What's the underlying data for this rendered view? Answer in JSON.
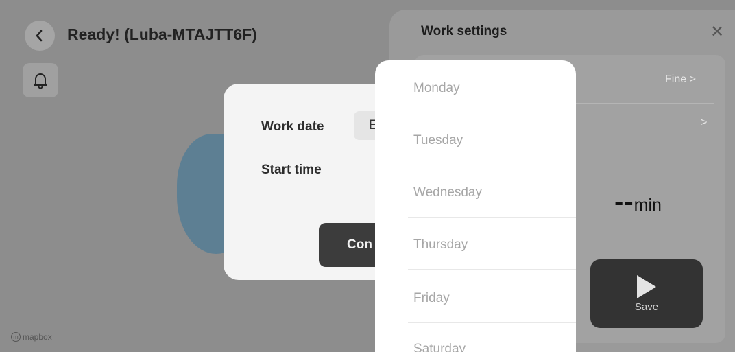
{
  "header": {
    "back_icon": "chevron-left-icon",
    "title": "Ready! (Luba-MTAJTT6F)",
    "notification_icon": "bell-icon"
  },
  "map": {
    "attribution": "mapbox",
    "zone_color": "#5d7f93"
  },
  "work_settings": {
    "title": "Work settings",
    "close_icon": "close-icon",
    "rows": [
      {
        "value": "Fine",
        "chevron": ">"
      },
      {
        "value": "",
        "chevron": ">"
      }
    ],
    "duration": {
      "value": "--",
      "unit": "min"
    },
    "save_label": "Save",
    "save_icon": "play-icon"
  },
  "schedule_dialog": {
    "work_date_label": "Work date",
    "work_date_value": "E",
    "start_time_label": "Start time",
    "confirm_label": "Con"
  },
  "day_picker": {
    "days": [
      "Monday",
      "Tuesday",
      "Wednesday",
      "Thursday",
      "Friday",
      "Saturday"
    ]
  },
  "colors": {
    "save_button": "#333333",
    "dialog_bg": "#f4f4f4",
    "day_text": "#a6a6a6"
  }
}
